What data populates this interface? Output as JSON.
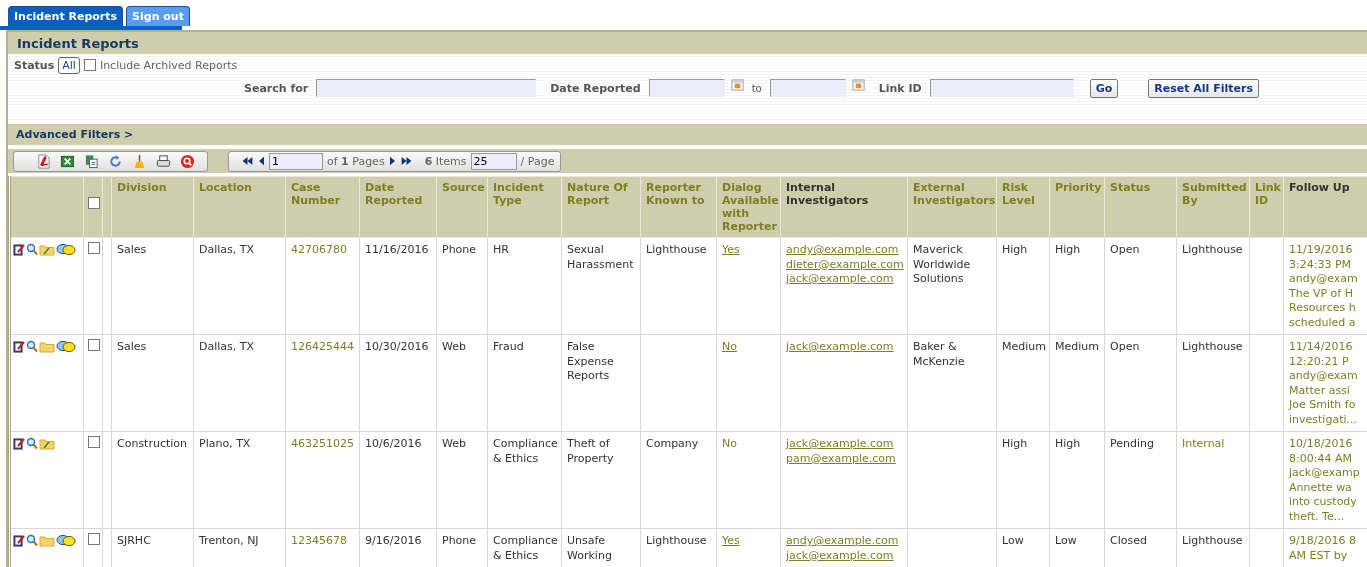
{
  "tabs": [
    {
      "label": "Incident Reports",
      "selected": true
    },
    {
      "label": "Sign out",
      "selected": false
    }
  ],
  "panel_title": "Incident Reports",
  "filters": {
    "status_label": "Status",
    "status_button": "All",
    "archived": {
      "label": "Include Archived Reports",
      "checked": false
    },
    "search_label": "Search for",
    "date_label": "Date Reported",
    "to_label": "to",
    "link_label": "Link ID",
    "go": "Go",
    "reset": "Reset All Filters"
  },
  "advanced_filters": "Advanced Filters >",
  "pager": {
    "page": "1",
    "of_pages": "of **1** Pages",
    "items": "**6** Items",
    "per_page": "25",
    "per_page_label": "/ Page"
  },
  "select_all": {
    "checked": false
  },
  "columns": [
    {
      "label": "Division",
      "sortable": true
    },
    {
      "label": "Location",
      "sortable": true
    },
    {
      "label": "Case Number",
      "sortable": true
    },
    {
      "label": "Date Reported",
      "sortable": true
    },
    {
      "label": "Source",
      "sortable": true
    },
    {
      "label": "Incident Type",
      "sortable": true
    },
    {
      "label": "Nature Of Report",
      "sortable": true
    },
    {
      "label": "Reporter Known to",
      "sortable": true
    },
    {
      "label": "Dialog Available with Reporter",
      "sortable": true
    },
    {
      "label": "Internal Investigators",
      "sortable": false
    },
    {
      "label": "External Investigators",
      "sortable": true
    },
    {
      "label": "Risk Level",
      "sortable": true
    },
    {
      "label": "Priority",
      "sortable": true
    },
    {
      "label": "Status",
      "sortable": true
    },
    {
      "label": "Submitted By",
      "sortable": true
    },
    {
      "label": "Link ID",
      "sortable": true
    },
    {
      "label": "Follow Up",
      "sortable": false
    }
  ],
  "rows": [
    {
      "checked": false,
      "has_dialog": true,
      "folder_notes": true,
      "division": "Sales",
      "location": "Dallas, TX",
      "case_number": "42706780",
      "date_reported": "11/16/2016",
      "source": "Phone",
      "incident_type": "HR",
      "nature": "Sexual Harassment",
      "reporter_known": "Lighthouse",
      "dialog": {
        "text": "Yes",
        "link": true
      },
      "internal": [
        "andy@example.com",
        "dieter@example.com",
        "jack@example.com"
      ],
      "external": "Maverick Worldwide Solutions",
      "risk": "High",
      "priority": "High",
      "status": "Open",
      "submitted": {
        "text": "Lighthouse",
        "link": false
      },
      "follow_up": [
        "11/19/2016",
        "3:24:33 PM",
        "andy@exam",
        "The VP of H",
        "Resources h",
        "scheduled a"
      ]
    },
    {
      "checked": false,
      "has_dialog": true,
      "folder_notes": false,
      "division": "Sales",
      "location": "Dallas, TX",
      "case_number": "126425444",
      "date_reported": "10/30/2016",
      "source": "Web",
      "incident_type": "Fraud",
      "nature": "False Expense Reports",
      "dialog": {
        "text": "No",
        "link": true
      },
      "internal": [
        "jack@example.com"
      ],
      "external": "Baker & McKenzie",
      "risk": "Medium",
      "priority": "Medium",
      "status": "Open",
      "submitted": {
        "text": "Lighthouse",
        "link": false
      },
      "follow_up": [
        "11/14/2016",
        "12:20:21 P",
        "andy@exam",
        "Matter assi",
        "Joe Smith fo",
        "investigati..."
      ]
    },
    {
      "checked": false,
      "has_dialog": false,
      "folder_notes": true,
      "division": "Construction",
      "location": "Plano, TX",
      "case_number": "463251025",
      "date_reported": "10/6/2016",
      "source": "Web",
      "incident_type": "Compliance & Ethics",
      "nature": "Theft of Property",
      "reporter_known": "Company",
      "dialog": {
        "text": "No",
        "link": false
      },
      "internal": [
        "jack@example.com",
        "pam@example.com"
      ],
      "risk": "High",
      "priority": "High",
      "status": "Pending",
      "submitted": {
        "text": "Internal",
        "link": true
      },
      "follow_up": [
        "10/18/2016",
        "8:00:44 AM",
        "jack@examp",
        "Annette wa",
        "into custody",
        "theft. Te..."
      ]
    },
    {
      "checked": false,
      "has_dialog": true,
      "folder_notes": false,
      "division": "SJRHC",
      "location": "Trenton, NJ",
      "case_number": "12345678",
      "date_reported": "9/16/2016",
      "source": "Phone",
      "incident_type": "Compliance & Ethics",
      "nature": "Unsafe Working",
      "reporter_known": "Lighthouse",
      "dialog": {
        "text": "Yes",
        "link": true
      },
      "internal": [
        "andy@example.com",
        "jack@example.com"
      ],
      "risk": "Low",
      "priority": "Low",
      "status": "Closed",
      "submitted": {
        "text": "Lighthouse",
        "link": false
      },
      "follow_up": [
        "9/18/2016 8",
        "AM EST by"
      ]
    }
  ]
}
